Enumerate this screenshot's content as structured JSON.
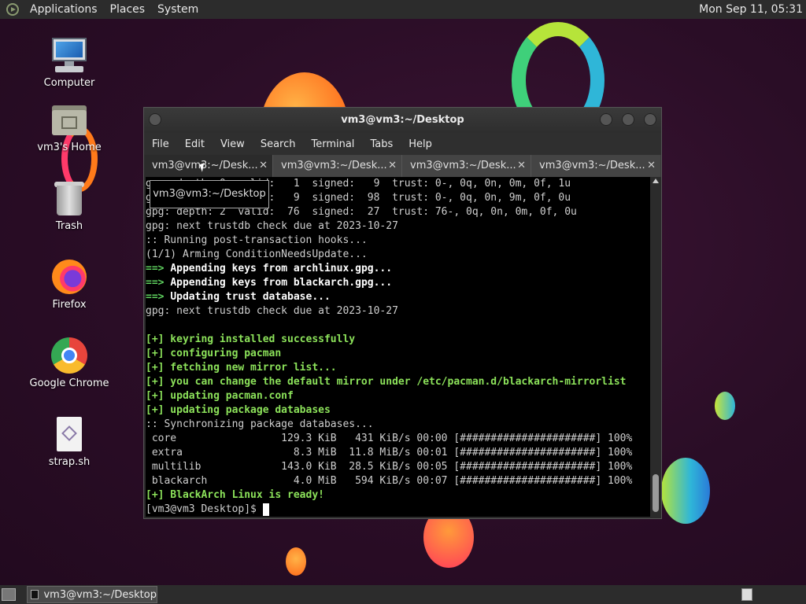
{
  "top_panel": {
    "menus": [
      "Applications",
      "Places",
      "System"
    ],
    "clock": "Mon Sep 11, 05:31"
  },
  "desktop_icons": [
    {
      "label": "Computer"
    },
    {
      "label": "vm3's Home"
    },
    {
      "label": "Trash"
    },
    {
      "label": "Firefox"
    },
    {
      "label": "Google Chrome"
    },
    {
      "label": "strap.sh"
    }
  ],
  "terminal": {
    "title": "vm3@vm3:~/Desktop",
    "menu": [
      "File",
      "Edit",
      "View",
      "Search",
      "Terminal",
      "Tabs",
      "Help"
    ],
    "tabs": [
      "vm3@vm3:~/Desk...",
      "vm3@vm3:~/Desk...",
      "vm3@vm3:~/Desk...",
      "vm3@vm3:~/Desk..."
    ],
    "tooltip": "vm3@vm3:~/Desktop",
    "lines": [
      {
        "text": "gpg: depth: 0  valid:   1  signed:   9  trust: 0-, 0q, 0n, 0m, 0f, 1u",
        "style": "plain"
      },
      {
        "text": "gpg: depth: 1  valid:   9  signed:  98  trust: 0-, 0q, 0n, 9m, 0f, 0u",
        "style": "plain"
      },
      {
        "text": "gpg: depth: 2  valid:  76  signed:  27  trust: 76-, 0q, 0n, 0m, 0f, 0u",
        "style": "plain"
      },
      {
        "text": "gpg: next trustdb check due at 2023-10-27",
        "style": "plain"
      },
      {
        "text": ":: Running post-transaction hooks...",
        "style": "plain"
      },
      {
        "text": "(1/1) Arming ConditionNeedsUpdate...",
        "style": "plain"
      },
      {
        "prefix": "==> ",
        "text": "Appending keys from archlinux.gpg...",
        "style": "arrow"
      },
      {
        "prefix": "==> ",
        "text": "Appending keys from blackarch.gpg...",
        "style": "arrow"
      },
      {
        "prefix": "==> ",
        "text": "Updating trust database...",
        "style": "arrow"
      },
      {
        "text": "gpg: next trustdb check due at 2023-10-27",
        "style": "plain"
      },
      {
        "text": "",
        "style": "plain"
      },
      {
        "text": "[+] keyring installed successfully",
        "style": "green"
      },
      {
        "text": "[+] configuring pacman",
        "style": "green"
      },
      {
        "text": "[+] fetching new mirror list...",
        "style": "green"
      },
      {
        "text": "[+] you can change the default mirror under /etc/pacman.d/blackarch-mirrorlist",
        "style": "green"
      },
      {
        "text": "[+] updating pacman.conf",
        "style": "green"
      },
      {
        "text": "[+] updating package databases",
        "style": "green"
      },
      {
        "text": ":: Synchronizing package databases...",
        "style": "plain"
      },
      {
        "text": " core                 129.3 KiB   431 KiB/s 00:00 [######################] 100%",
        "style": "plain"
      },
      {
        "text": " extra                  8.3 MiB  11.8 MiB/s 00:01 [######################] 100%",
        "style": "plain"
      },
      {
        "text": " multilib             143.0 KiB  28.5 KiB/s 00:05 [######################] 100%",
        "style": "plain"
      },
      {
        "text": " blackarch              4.0 MiB   594 KiB/s 00:07 [######################] 100%",
        "style": "plain"
      },
      {
        "text": "[+] BlackArch Linux is ready!",
        "style": "green"
      },
      {
        "text": "[vm3@vm3 Desktop]$ ",
        "style": "prompt"
      }
    ]
  },
  "bottom_panel": {
    "task_label": "vm3@vm3:~/Desktop"
  },
  "icons": {
    "distro": "distro-logo-icon",
    "show_desktop": "show-desktop-icon",
    "terminal_task": "terminal-icon"
  }
}
